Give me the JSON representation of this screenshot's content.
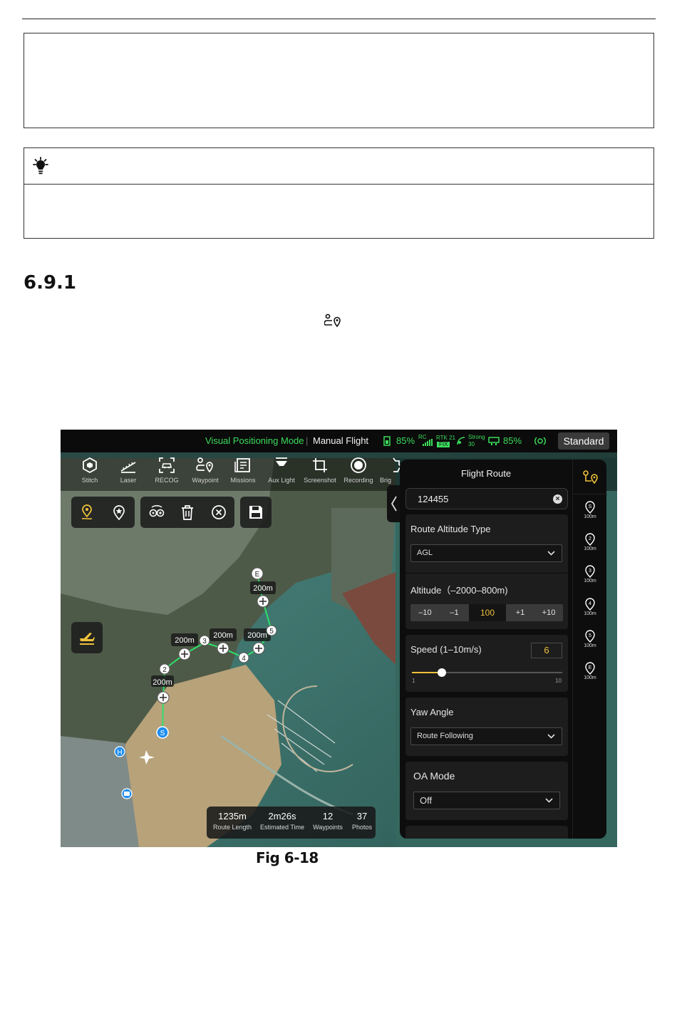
{
  "section_number": "6.9.1",
  "figure_caption": "Fig 6-18",
  "status_bar": {
    "mode_visual": "Visual Positioning Mode",
    "mode_flight": "Manual Flight",
    "battery_pct": "85%",
    "rc_label": "RC",
    "rtk_label": "RTK 21",
    "rtk_fix": "FIX",
    "signal_label": "Strong",
    "signal_num": "30",
    "remote_battery_pct": "85%",
    "profile_button": "Standard"
  },
  "toolbar": [
    {
      "label": "Stitch",
      "icon": "stitch-icon"
    },
    {
      "label": "Laser",
      "icon": "laser-icon"
    },
    {
      "label": "RECOG",
      "icon": "recog-icon"
    },
    {
      "label": "Waypoint",
      "icon": "waypoint-icon"
    },
    {
      "label": "Missions",
      "icon": "missions-icon"
    },
    {
      "label": "Aux Light",
      "icon": "aux-light-icon"
    },
    {
      "label": "Screenshot",
      "icon": "screenshot-icon"
    },
    {
      "label": "Recording",
      "icon": "recording-icon"
    },
    {
      "label": "Brig",
      "icon": "brightness-icon"
    }
  ],
  "edit_tools": [
    "add-waypoint-icon",
    "point-of-interest-icon",
    "link-icon",
    "delete-icon",
    "close-icon",
    "save-icon"
  ],
  "map": {
    "segment_labels": [
      "200m",
      "200m",
      "200m",
      "200m",
      "200m"
    ],
    "waypoint_labels": [
      "S",
      "2",
      "3",
      "4",
      "5",
      "E"
    ],
    "home_marker": "H"
  },
  "route_stats": [
    {
      "value": "1235m",
      "label": "Route Length"
    },
    {
      "value": "2m26s",
      "label": "Estimated Time"
    },
    {
      "value": "12",
      "label": "Waypoints"
    },
    {
      "value": "37",
      "label": "Photos"
    }
  ],
  "flight_route_panel": {
    "title": "Flight Route",
    "route_name": "124455",
    "altitude_type_label": "Route Altitude Type",
    "altitude_type_value": "AGL",
    "altitude_label": "Altitude（–2000–800m)",
    "altitude_buttons": [
      "–10",
      "–1",
      "100",
      "+1",
      "+10"
    ],
    "speed_label": "Speed (1–10m/s)",
    "speed_value": "6",
    "speed_min": "1",
    "speed_max": "10",
    "speed_fraction": 0.2,
    "yaw_label": "Yaw Angle",
    "yaw_value": "Route Following",
    "oa_label": "OA Mode",
    "oa_value": "Off"
  },
  "waypoint_list": [
    {
      "id": "S",
      "height": "100m"
    },
    {
      "id": "2",
      "height": "100m"
    },
    {
      "id": "3",
      "height": "100m"
    },
    {
      "id": "4",
      "height": "100m"
    },
    {
      "id": "5",
      "height": "100m"
    },
    {
      "id": "E",
      "height": "100m"
    }
  ],
  "colors": {
    "status_green": "#3bdc5b",
    "accent_yellow": "#f0c23a",
    "route_line": "#2ee06a",
    "waypoint_blue": "#1f8ef0"
  }
}
